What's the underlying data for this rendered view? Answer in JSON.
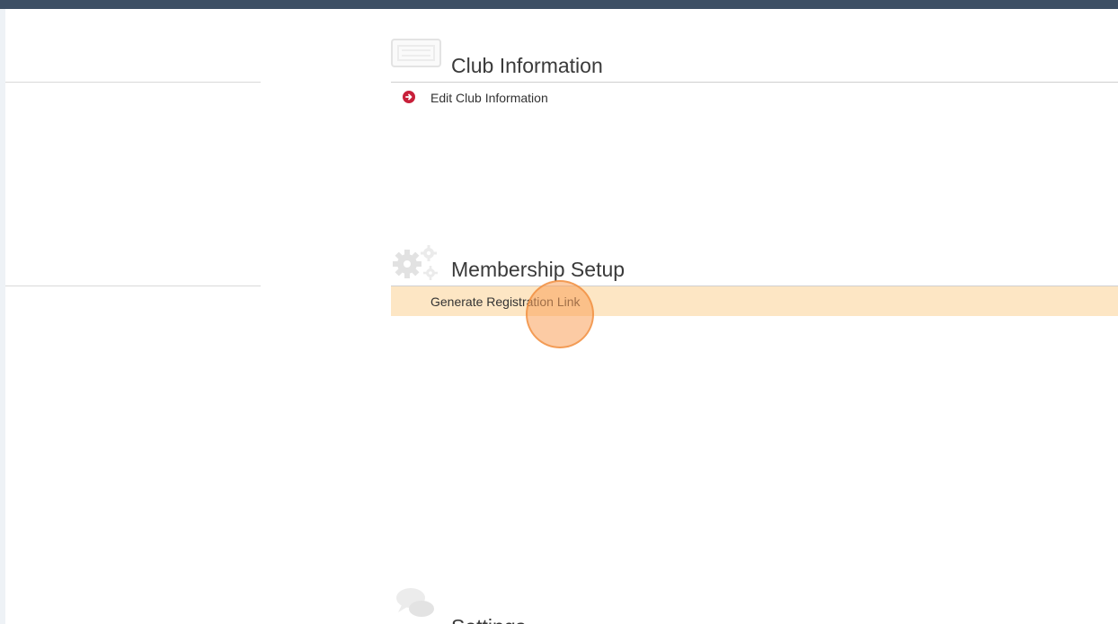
{
  "sections": {
    "club_information": {
      "title": "Club Information",
      "icon": "keyboard-icon",
      "links": [
        {
          "label": "Edit Club Information",
          "icon": "arrow-circle-right-icon"
        }
      ]
    },
    "membership_setup": {
      "title": "Membership Setup",
      "icon": "gears-icon",
      "links": [
        {
          "label": "Generate Registration Link",
          "highlighted": true
        }
      ]
    },
    "settings": {
      "title": "Settings",
      "icon": "chat-bubbles-icon"
    }
  },
  "colors": {
    "top_bar": "#3d4f64",
    "link_arrow": "#c8203a",
    "highlight_row": "#fde6c4",
    "click_indicator": "#f5a05a"
  }
}
